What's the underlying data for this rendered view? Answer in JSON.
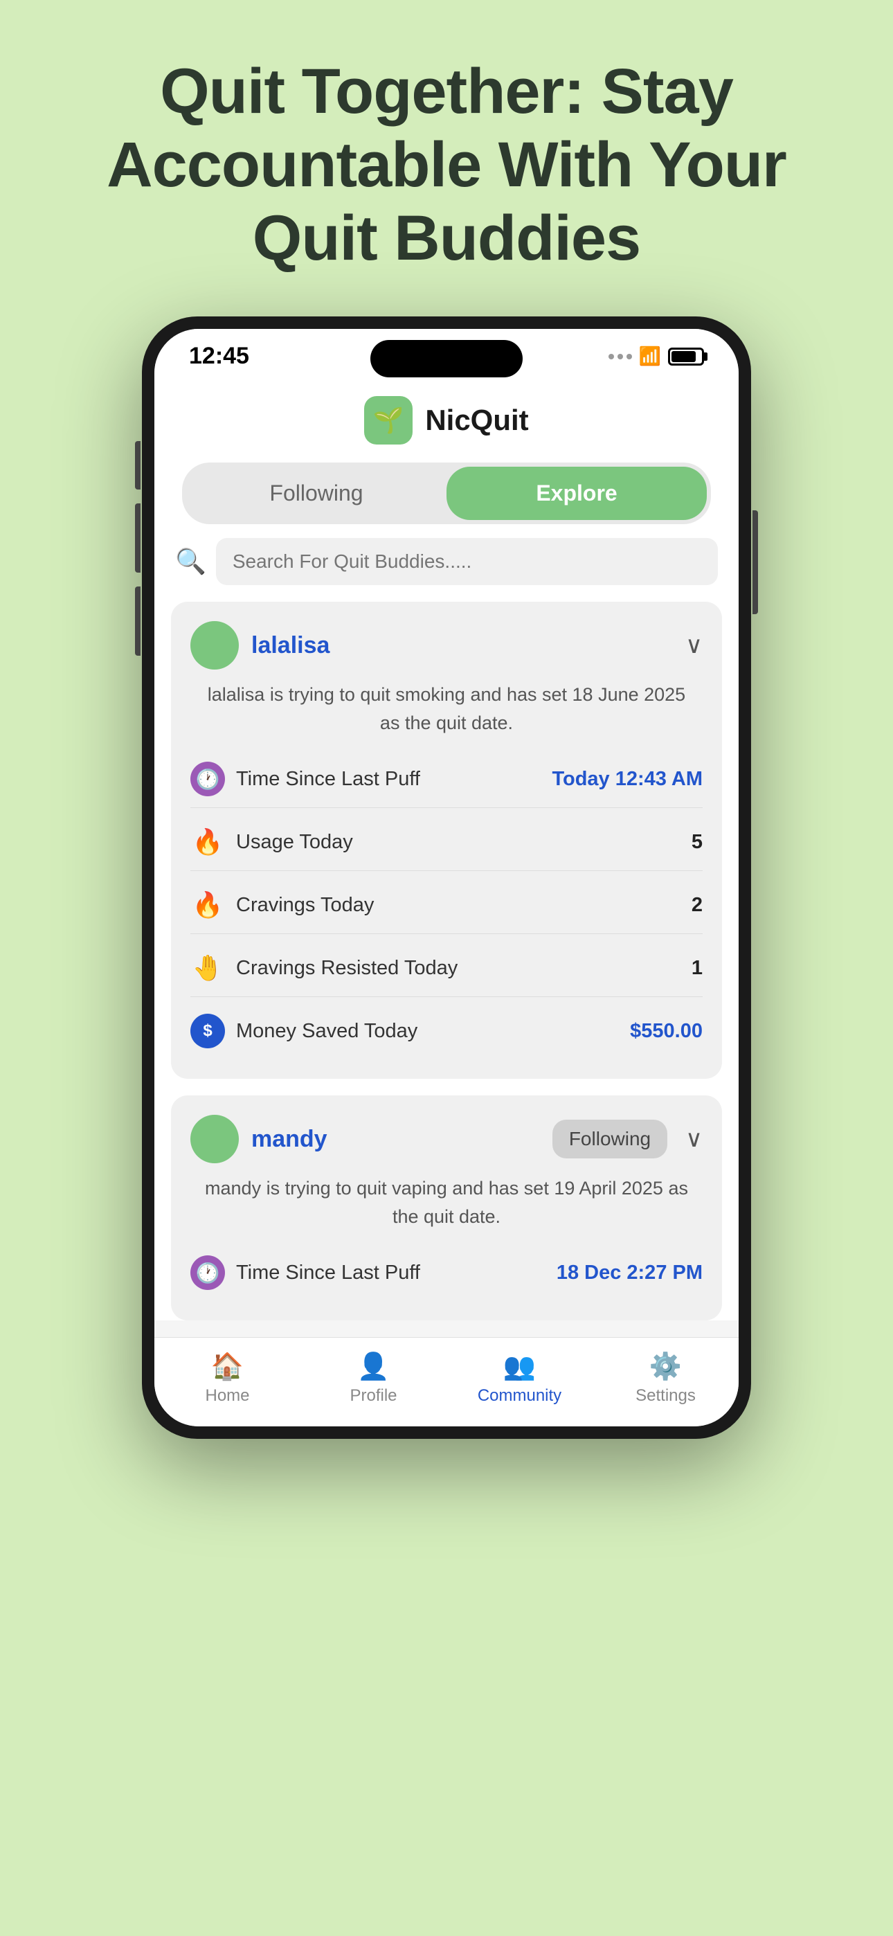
{
  "page": {
    "background_color": "#d4edbb",
    "title": "Quit Together: Stay Accountable With Your Quit Buddies"
  },
  "status_bar": {
    "time": "12:45",
    "battery_level": 75
  },
  "app": {
    "name": "NicQuit",
    "logo_emoji": "🌱"
  },
  "tabs": {
    "following_label": "Following",
    "explore_label": "Explore",
    "active": "explore"
  },
  "search": {
    "placeholder": "Search For Quit Buddies....."
  },
  "users": [
    {
      "id": "lalalisa",
      "name": "lalalisa",
      "description": "lalalisa is trying to quit smoking and has set 18 June 2025 as the quit date.",
      "has_following_badge": false,
      "stats": [
        {
          "icon_type": "clock",
          "label": "Time Since Last Puff",
          "value": "Today 12:43 AM",
          "value_color": "blue"
        },
        {
          "icon_type": "fire_orange",
          "label": "Usage Today",
          "value": "5",
          "value_color": "dark"
        },
        {
          "icon_type": "fire_yellow",
          "label": "Cravings Today",
          "value": "2",
          "value_color": "dark"
        },
        {
          "icon_type": "hand",
          "label": "Cravings Resisted Today",
          "value": "1",
          "value_color": "dark"
        },
        {
          "icon_type": "dollar",
          "label": "Money Saved Today",
          "value": "$550.00",
          "value_color": "blue"
        }
      ]
    },
    {
      "id": "mandy",
      "name": "mandy",
      "description": "mandy is trying to quit vaping and has set 19 April 2025 as the quit date.",
      "has_following_badge": true,
      "following_label": "Following",
      "stats": [
        {
          "icon_type": "clock",
          "label": "Time Since Last Puff",
          "value": "18 Dec 2:27 PM",
          "value_color": "blue"
        }
      ]
    }
  ],
  "bottom_nav": {
    "items": [
      {
        "id": "home",
        "label": "Home",
        "active": false
      },
      {
        "id": "profile",
        "label": "Profile",
        "active": false
      },
      {
        "id": "community",
        "label": "Community",
        "active": true
      },
      {
        "id": "settings",
        "label": "Settings",
        "active": false
      }
    ]
  }
}
